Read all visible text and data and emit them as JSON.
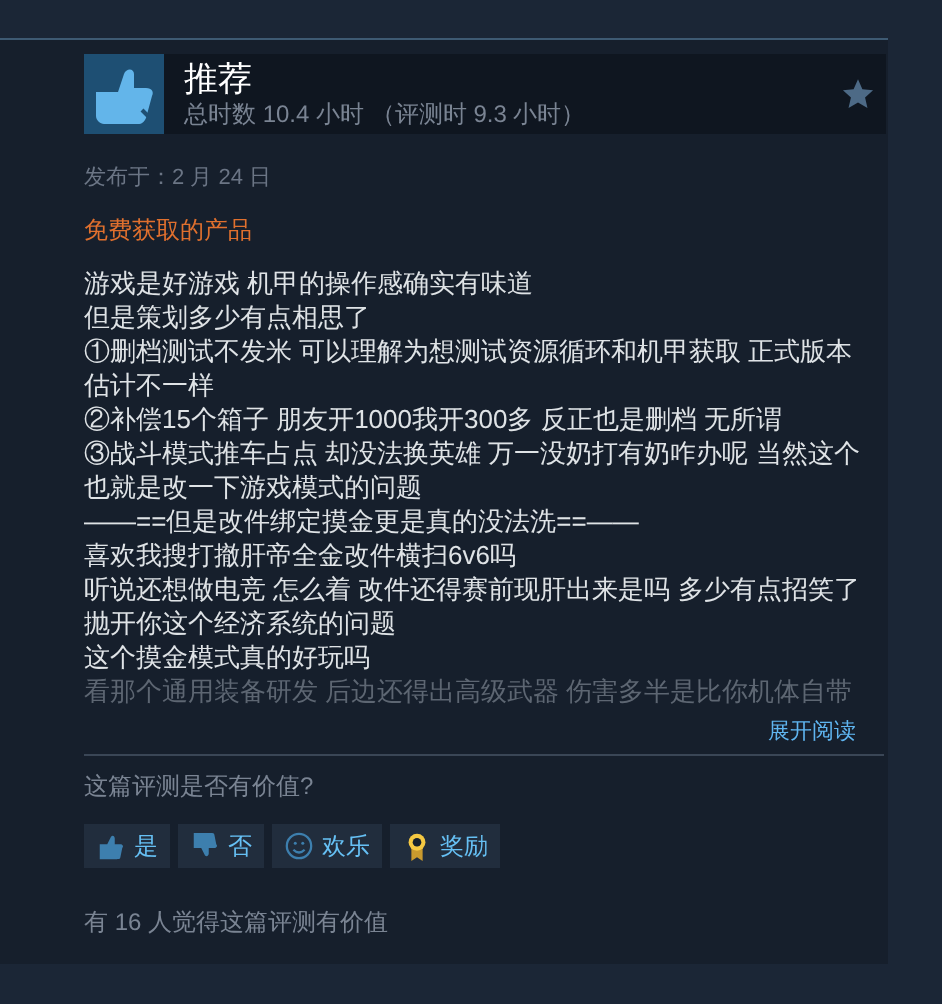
{
  "review": {
    "verdict": "推荐",
    "playtime": "总时数 10.4 小时 （评测时 9.3 小时）",
    "posted": "发布于：2 月 24 日",
    "free_label": "免费获取的产品",
    "paragraphs": [
      {
        "text": "游戏是好游戏 机甲的操作感确实有味道",
        "faded": false
      },
      {
        "text": "但是策划多少有点相思了",
        "faded": false
      },
      {
        "text": "①删档测试不发米 可以理解为想测试资源循环和机甲获取 正式版本估计不一样",
        "faded": false
      },
      {
        "text": "②补偿15个箱子 朋友开1000我开300多 反正也是删档 无所谓",
        "faded": false
      },
      {
        "text": "③战斗模式推车占点 却没法换英雄 万一没奶打有奶咋办呢 当然这个也就是改一下游戏模式的问题",
        "faded": false
      },
      {
        "text": "——==但是改件绑定摸金更是真的没法洗==——",
        "faded": false
      },
      {
        "text": "喜欢我搜打撤肝帝全金改件横扫6v6吗",
        "faded": false
      },
      {
        "text": "听说还想做电竞 怎么着 改件还得赛前现肝出来是吗 多少有点招笑了",
        "faded": false
      },
      {
        "text": "抛开你这个经济系统的问题",
        "faded": false
      },
      {
        "text": "这个摸金模式真的好玩吗",
        "faded": false
      },
      {
        "text": "看那个通用装备研发 后边还得出高级武器 伤害多半是比你机体自带",
        "faded": true
      }
    ],
    "expand": "展开阅读",
    "question": "这篇评测是否有价值?",
    "buttons": [
      {
        "kind": "yes",
        "label": "是"
      },
      {
        "kind": "no",
        "label": "否"
      },
      {
        "kind": "funny",
        "label": "欢乐"
      },
      {
        "kind": "award",
        "label": "奖励"
      }
    ],
    "helpful": "有 16 人觉得这篇评测有价值"
  }
}
